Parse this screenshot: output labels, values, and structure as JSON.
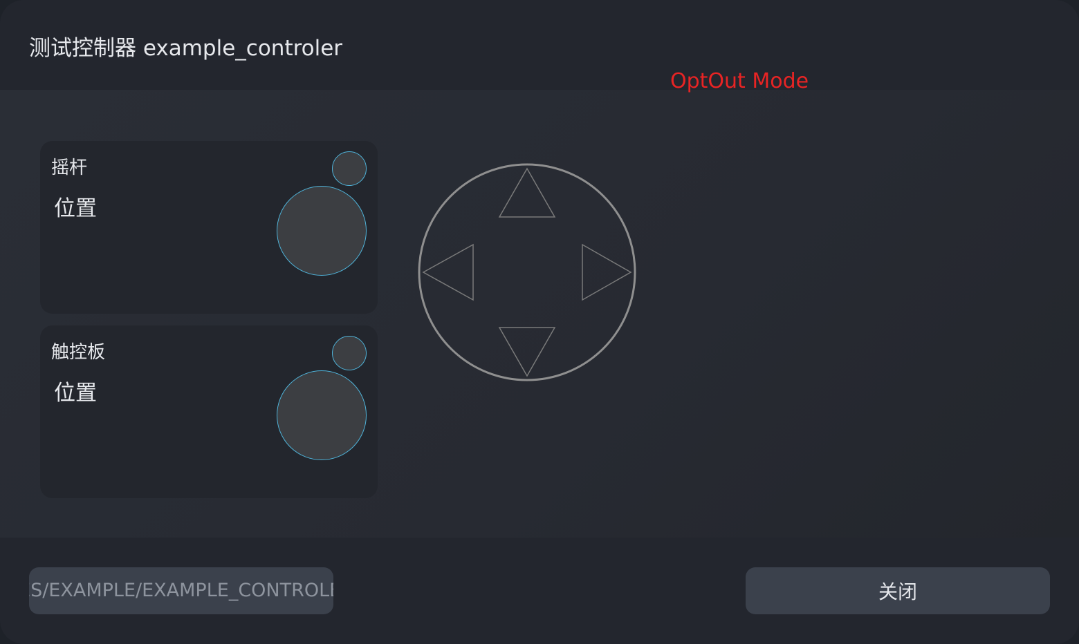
{
  "window": {
    "title": "测试控制器 example_controler"
  },
  "status": {
    "mode_label": "OptOut Mode"
  },
  "panels": [
    {
      "title": "摇杆",
      "position_label": "位置"
    },
    {
      "title": "触控板",
      "position_label": "位置"
    }
  ],
  "footer": {
    "path_value": "/DEVICES/EXAMPLE/EXAMPLE_CONTROLER",
    "close_label": "关闭"
  },
  "colors": {
    "accent_circle_border": "#4fb3d9",
    "mode_label": "#e82424",
    "button_bg": "#3b414c",
    "dpad_stroke": "#8a8a8a"
  },
  "icons": {
    "dpad": "dpad-icon",
    "up": "arrow-up-icon",
    "down": "arrow-down-icon",
    "left": "arrow-left-icon",
    "right": "arrow-right-icon"
  }
}
